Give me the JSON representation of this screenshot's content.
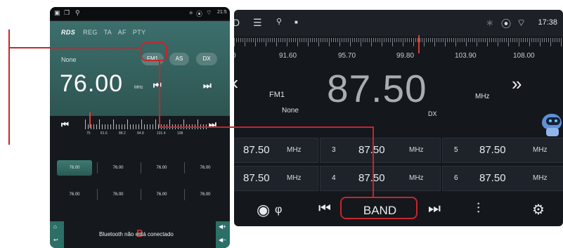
{
  "left_screen": {
    "status_time": "21:5",
    "rds": {
      "logo": "RDS",
      "flags": [
        "REG",
        "TA",
        "AF",
        "PTY"
      ]
    },
    "ps_name": "None",
    "band_chip": "FM1",
    "as_chip": "AS",
    "dx_chip": "DX",
    "frequency": "76.00",
    "unit": "MHz",
    "dial_labels": [
      "75",
      "81.6",
      "88.2",
      "94.8",
      "101.4",
      "108"
    ],
    "presets_row1": [
      "76.00",
      "76.00",
      "76.00",
      "76.00"
    ],
    "presets_row2": [
      "76.00",
      "76.00",
      "76.00",
      "76.00"
    ],
    "bluetooth_status": "Bluetooth não está conectado"
  },
  "right_screen": {
    "status_time": "17:38",
    "scale_labels": [
      "0",
      "91.60",
      "95.70",
      "99.80",
      "103.90",
      "108.00"
    ],
    "band": "FM1",
    "frequency": "87.50",
    "unit": "MHz",
    "ps_name": "None",
    "dx": "DX",
    "presets": [
      {
        "num": "",
        "freq": "87.50",
        "unit": "MHz"
      },
      {
        "num": "3",
        "freq": "87.50",
        "unit": "MHz"
      },
      {
        "num": "5",
        "freq": "87.50",
        "unit": "MHz"
      },
      {
        "num": "",
        "freq": "87.50",
        "unit": "MHz"
      },
      {
        "num": "4",
        "freq": "87.50",
        "unit": "MHz"
      },
      {
        "num": "6",
        "freq": "87.50",
        "unit": "MHz"
      }
    ],
    "band_button": "BAND"
  },
  "colors": {
    "annotation": "#c6262c",
    "panel": "#3c6f6c",
    "accent": "#2c6f66"
  },
  "icons": [
    "menu-icon",
    "usb-icon",
    "bluetooth-icon",
    "location-icon",
    "wifi-icon",
    "podcast-icon",
    "prev-icon",
    "next-icon",
    "equalizer-icon",
    "settings-icon",
    "home-icon",
    "back-icon",
    "volume-up-icon",
    "volume-down-icon",
    "assistant-robot-icon"
  ]
}
